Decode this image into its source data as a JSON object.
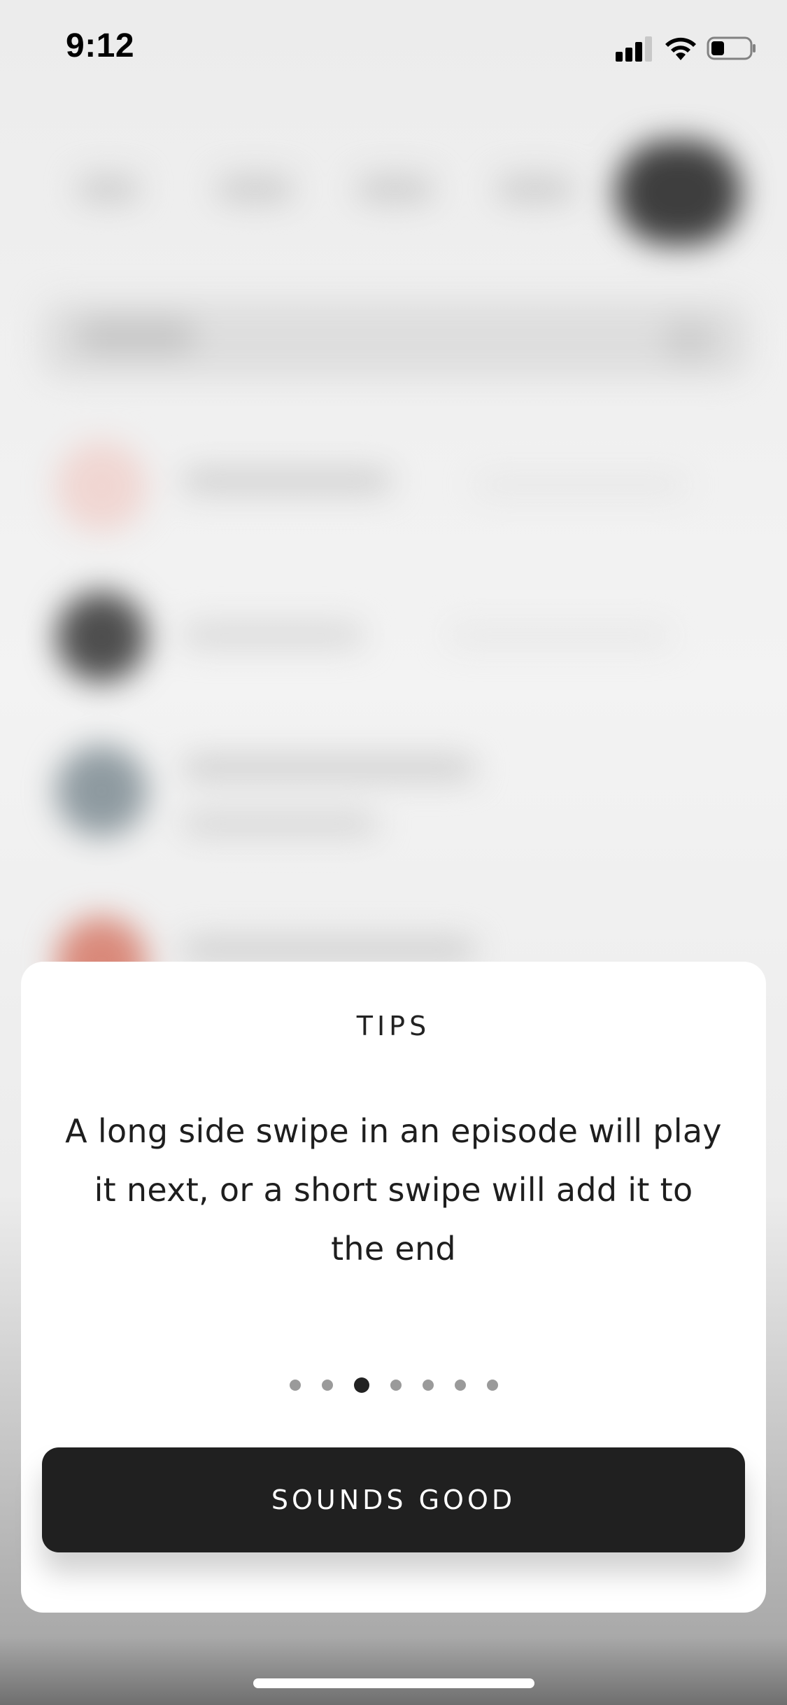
{
  "status_bar": {
    "time": "9:12",
    "signal_icon": "cellular-signal-icon",
    "wifi_icon": "wifi-icon",
    "battery_icon": "battery-icon",
    "battery_level": 0.35
  },
  "tips_sheet": {
    "title": "TIPS",
    "message": "A long side swipe in an episode will play it next, or a short swipe will add it to the end",
    "pagination": {
      "total_pages": 7,
      "current_page": 3
    },
    "primary_button_label": "SOUNDS GOOD"
  },
  "colors": {
    "sheet_background": "#ffffff",
    "button_background": "#202020",
    "button_text": "#ffffff",
    "dot_active": "#222222",
    "dot_inactive": "#9a9a9a"
  }
}
